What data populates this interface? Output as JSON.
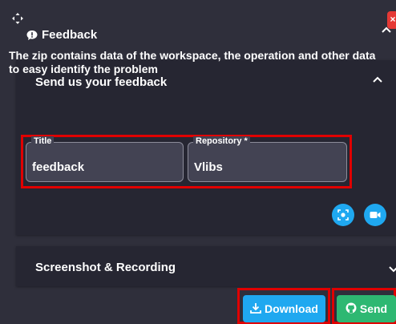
{
  "header": {
    "title": "Feedback",
    "icon": "chat-bubble-icon"
  },
  "section_feedback": {
    "title": "Send us your feedback",
    "description": "The zip contains data of the workspace, the operation and other data to easy identify the problem",
    "fields": [
      {
        "label": "Title",
        "value": "feedback"
      },
      {
        "label": "Repository *",
        "value": "Vlibs"
      }
    ]
  },
  "section_screenshot": {
    "title": "Screenshot & Recording"
  },
  "actions": {
    "download_label": "Download",
    "send_label": "Send"
  },
  "colors": {
    "panel_bg": "#2f2f3b",
    "section_bg": "#262632",
    "field_bg": "#434353",
    "accent_blue": "#1fa8f0",
    "accent_green": "#2eb872",
    "highlight_red": "#e00000"
  }
}
